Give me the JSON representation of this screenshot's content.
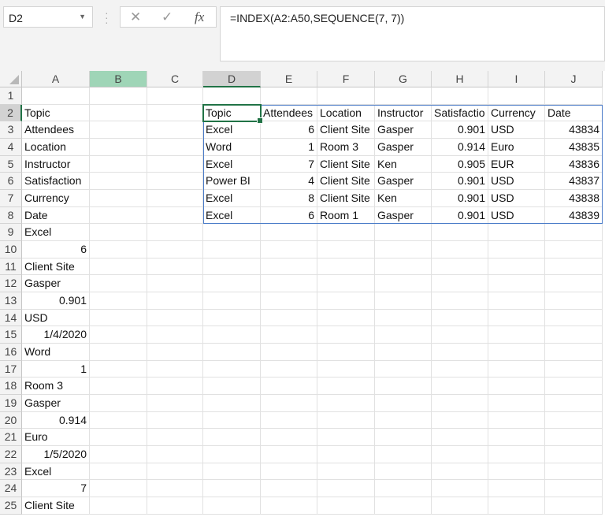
{
  "name_box": {
    "value": "D2"
  },
  "formula_bar": {
    "cancel_icon": "✕",
    "enter_icon": "✓",
    "fx_label": "fx",
    "formula": "=INDEX(A2:A50,SEQUENCE(7, 7))"
  },
  "colors": {
    "accent": "#217346",
    "spill_border": "#4a7bc8",
    "highlight_column": "#9fd5b7"
  },
  "selected_cell": "D2",
  "columns": [
    "A",
    "B",
    "C",
    "D",
    "E",
    "F",
    "G",
    "H",
    "I",
    "J"
  ],
  "rows": [
    "1",
    "2",
    "3",
    "4",
    "5",
    "6",
    "7",
    "8",
    "9",
    "10",
    "11",
    "12",
    "13",
    "14",
    "15",
    "16",
    "17",
    "18",
    "19",
    "20",
    "21",
    "22",
    "23",
    "24",
    "25"
  ],
  "column_a": [
    "",
    "Topic",
    "Attendees",
    "Location",
    "Instructor",
    "Satisfaction",
    "Currency",
    "Date",
    "Excel",
    "6",
    "Client Site",
    "Gasper",
    "0.901",
    "USD",
    "1/4/2020",
    "Word",
    "1",
    "Room 3",
    "Gasper",
    "0.914",
    "Euro",
    "1/5/2020",
    "Excel",
    "7",
    "Client Site"
  ],
  "spill_headers": [
    "Topic",
    "Attendees",
    "Location",
    "Instructor",
    "Satisfactio",
    "Currency",
    "Date"
  ],
  "spill_rows": [
    [
      "Excel",
      "6",
      "Client Site",
      "Gasper",
      "0.901",
      "USD",
      "43834"
    ],
    [
      "Word",
      "1",
      "Room 3",
      "Gasper",
      "0.914",
      "Euro",
      "43835"
    ],
    [
      "Excel",
      "7",
      "Client Site",
      "Ken",
      "0.905",
      "EUR",
      "43836"
    ],
    [
      "Power BI",
      "4",
      "Client Site",
      "Gasper",
      "0.901",
      "USD",
      "43837"
    ],
    [
      "Excel",
      "8",
      "Client Site",
      "Ken",
      "0.901",
      "USD",
      "43838"
    ],
    [
      "Excel",
      "6",
      "Room 1",
      "Gasper",
      "0.901",
      "USD",
      "43839"
    ]
  ]
}
